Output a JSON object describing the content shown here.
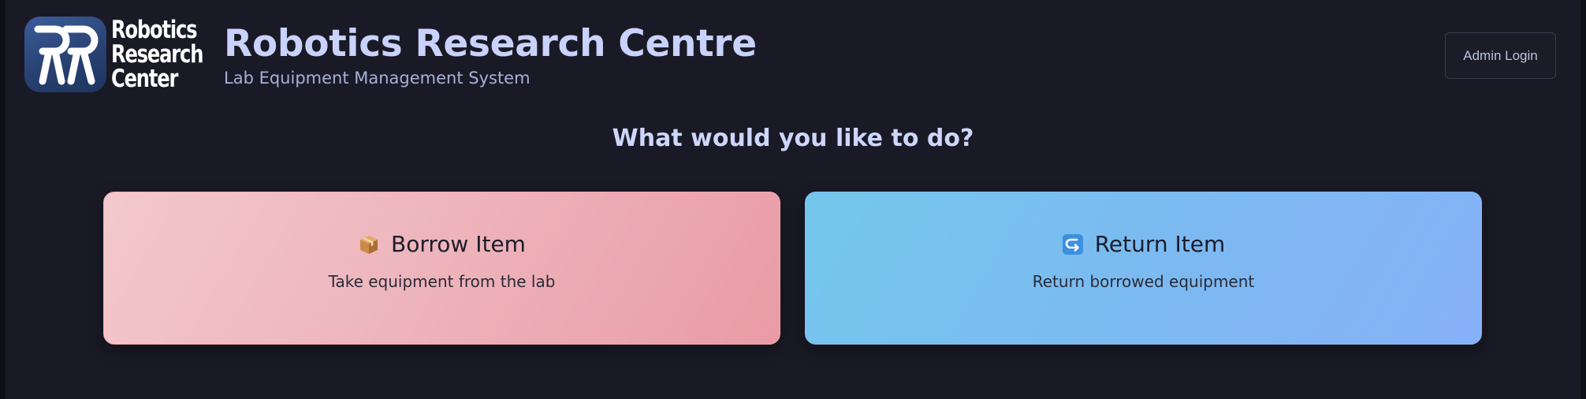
{
  "logo": {
    "monogram": "RR",
    "text_lines": [
      "Robotics",
      "Research",
      "Center"
    ]
  },
  "header": {
    "title": "Robotics Research Centre",
    "subtitle": "Lab Equipment Management System",
    "admin_login_label": "Admin Login"
  },
  "main": {
    "prompt": "What would you like to do?",
    "actions": [
      {
        "icon": "package-icon",
        "title": "Borrow Item",
        "description": "Take equipment from the lab",
        "color_start": "#f2c9cd",
        "color_end": "#e99ba6"
      },
      {
        "icon": "return-arrow-icon",
        "title": "Return Item",
        "description": "Return borrowed equipment",
        "color_start": "#74c7ec",
        "color_end": "#87b0f8"
      }
    ]
  },
  "colors": {
    "background": "#1a1a26",
    "title": "#c9d2fb",
    "subtitle": "#a6b0d8"
  }
}
